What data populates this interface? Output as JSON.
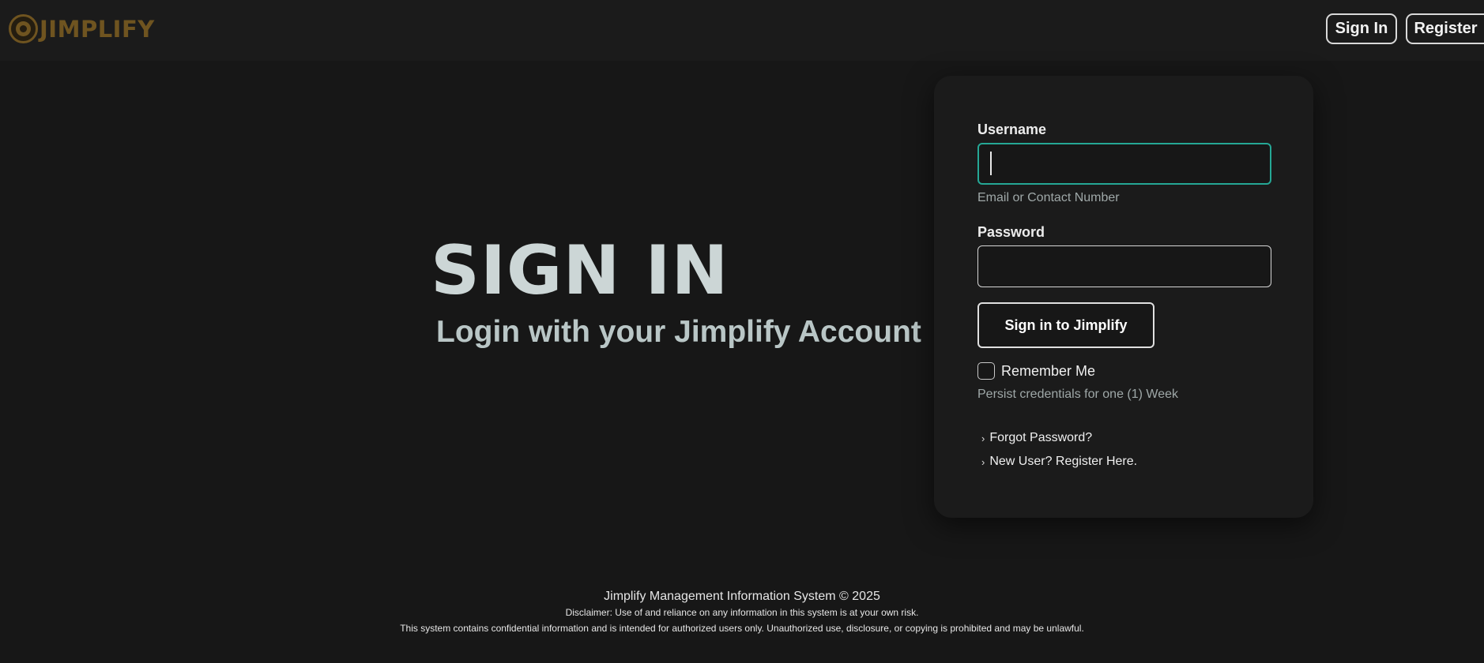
{
  "brand": {
    "name": "JIMPLIFY",
    "logo_icon": "jimplify-logo-icon",
    "color": "#6f5420"
  },
  "nav": {
    "signin_label": "Sign In",
    "register_label": "Register"
  },
  "hero": {
    "title": "SIGN IN",
    "subtitle": "Login with your Jimplify Account"
  },
  "form": {
    "username_label": "Username",
    "username_value": "",
    "username_help": "Email or Contact Number",
    "password_label": "Password",
    "password_value": "",
    "submit_label": "Sign in to Jimplify",
    "remember_label": "Remember Me",
    "remember_checked": false,
    "remember_help": "Persist credentials for one (1) Week",
    "links": [
      {
        "label": "Forgot Password?",
        "icon": "chevron-right-icon"
      },
      {
        "label": "New User? Register Here.",
        "icon": "chevron-right-icon"
      }
    ],
    "focus_color": "#25a795"
  },
  "footer": {
    "line1": "Jimplify Management Information System © 2025",
    "line2": "Disclaimer: Use of and reliance on any information in this system is at your own risk.",
    "line3": "This system contains confidential information and is intended for authorized users only. Unauthorized use, disclosure, or copying is prohibited and may be unlawful."
  }
}
